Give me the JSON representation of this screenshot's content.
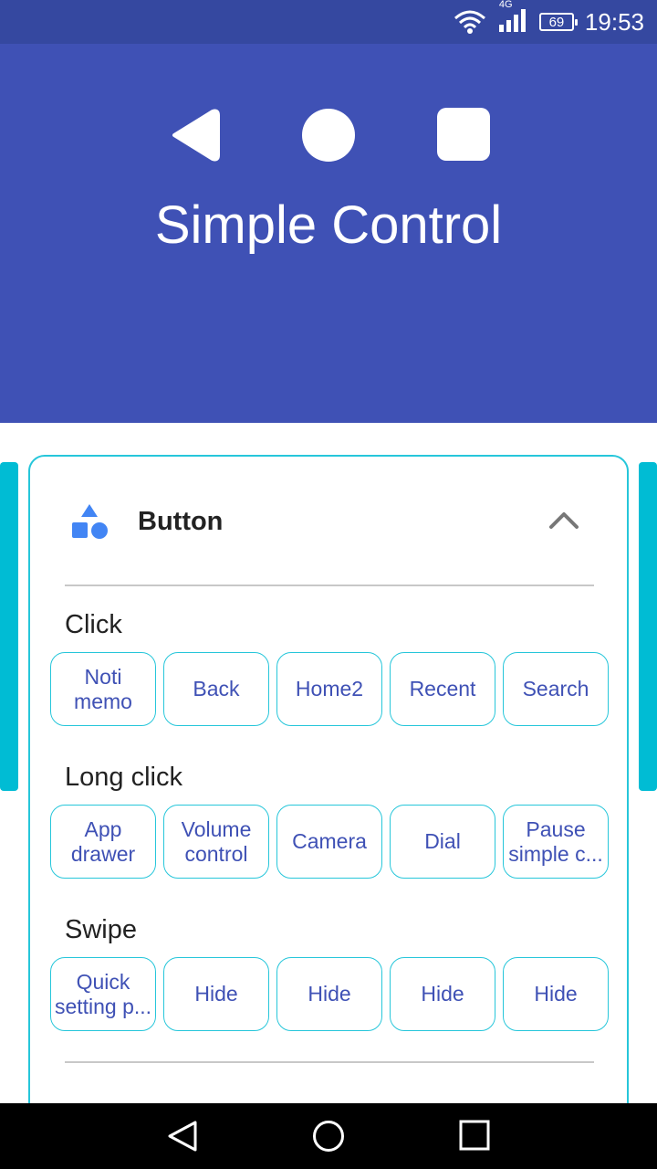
{
  "status_bar": {
    "network": "4G",
    "battery": "69",
    "time": "19:53"
  },
  "header": {
    "title": "Simple Control",
    "icons": [
      "back-triangle-icon",
      "home-circle-icon",
      "recent-square-icon"
    ]
  },
  "card": {
    "title": "Button",
    "icon": "shapes-icon",
    "sections": [
      {
        "label": "Click",
        "buttons": [
          "Noti memo",
          "Back",
          "Home2",
          "Recent",
          "Search"
        ]
      },
      {
        "label": "Long click",
        "buttons": [
          "App drawer",
          "Volume control",
          "Camera",
          "Dial",
          "Pause simple c..."
        ]
      },
      {
        "label": "Swipe",
        "buttons": [
          "Quick setting p...",
          "Hide",
          "Hide",
          "Hide",
          "Hide"
        ]
      }
    ]
  },
  "colors": {
    "primary": "#3f51b5",
    "status_bar": "#3548a0",
    "accent": "#00bcd4",
    "chip_border": "#26c6da",
    "icon_blue": "#4285f4"
  }
}
